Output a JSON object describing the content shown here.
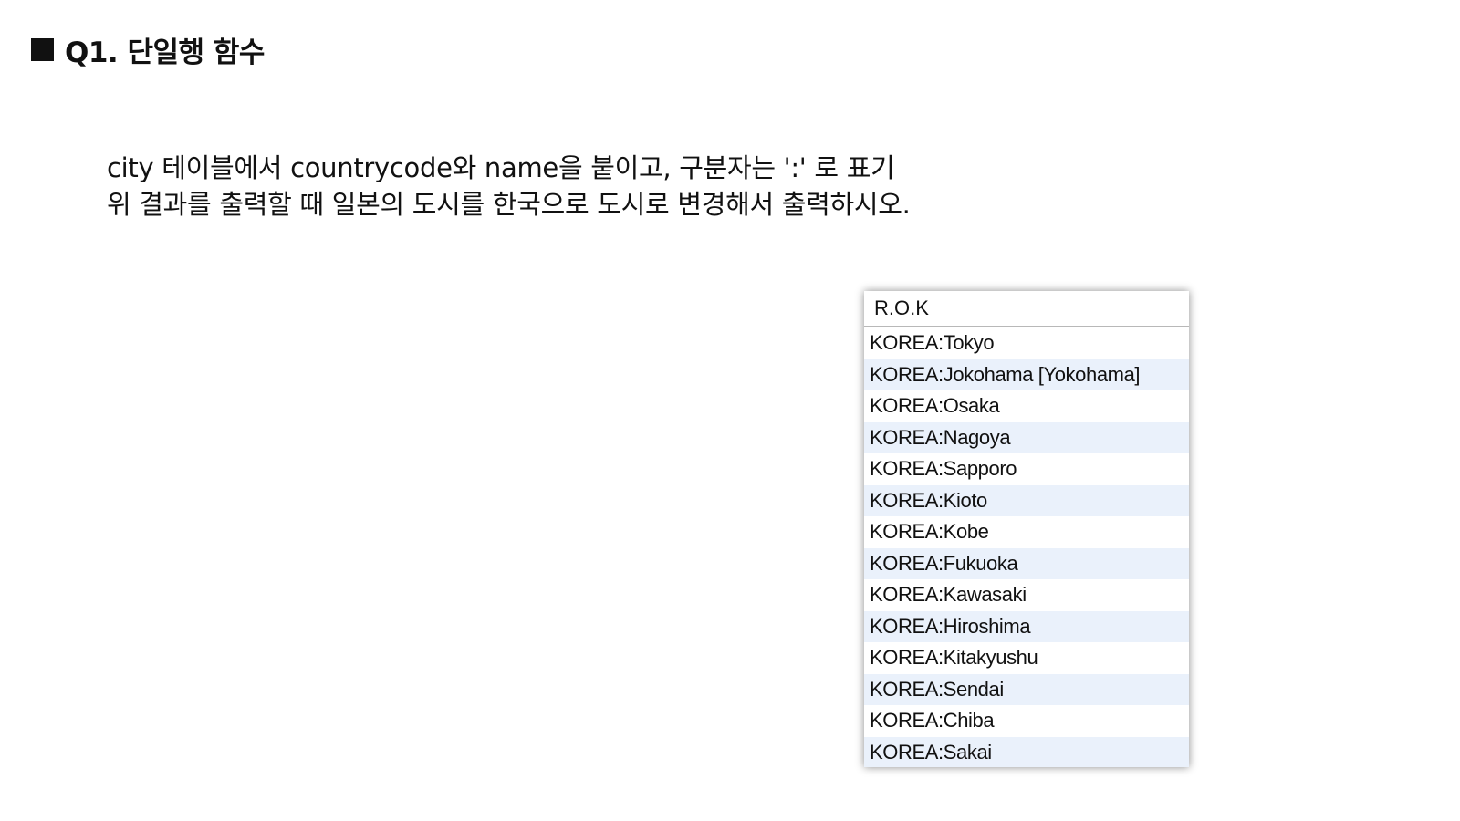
{
  "slide": {
    "title": "Q1. 단일행 함수",
    "bullet_icon": "black-square"
  },
  "instructions": {
    "line1": "city 테이블에서 countrycode와 name을 붙이고, 구분자는 ':' 로 표기",
    "line2": "위 결과를 출력할 때 일본의 도시를 한국으로 도시로 변경해서 출력하시오."
  },
  "result": {
    "column_header": "R.O.K",
    "rows": [
      "KOREA:Tokyo",
      "KOREA:Jokohama [Yokohama]",
      "KOREA:Osaka",
      "KOREA:Nagoya",
      "KOREA:Sapporo",
      "KOREA:Kioto",
      "KOREA:Kobe",
      "KOREA:Fukuoka",
      "KOREA:Kawasaki",
      "KOREA:Hiroshima",
      "KOREA:Kitakyushu",
      "KOREA:Sendai",
      "KOREA:Chiba",
      "KOREA:Sakai"
    ],
    "alt_row_color": "#eaf1fb"
  }
}
